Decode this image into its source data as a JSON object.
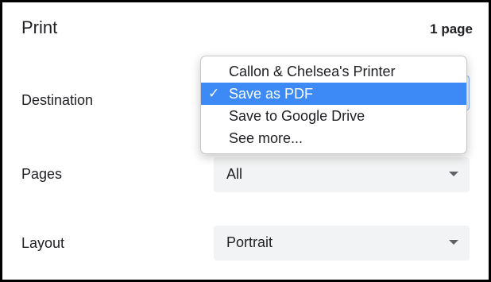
{
  "dialog": {
    "title": "Print",
    "page_count": "1 page"
  },
  "destination": {
    "label": "Destination",
    "menu": {
      "items": [
        {
          "label": "Callon & Chelsea's Printer",
          "selected": false
        },
        {
          "label": "Save as PDF",
          "selected": true
        },
        {
          "label": "Save to Google Drive",
          "selected": false
        },
        {
          "label": "See more...",
          "selected": false
        }
      ],
      "check_glyph": "✓",
      "highlight_color": "#3d8af7"
    }
  },
  "pages": {
    "label": "Pages",
    "value": "All"
  },
  "layout": {
    "label": "Layout",
    "value": "Portrait"
  }
}
